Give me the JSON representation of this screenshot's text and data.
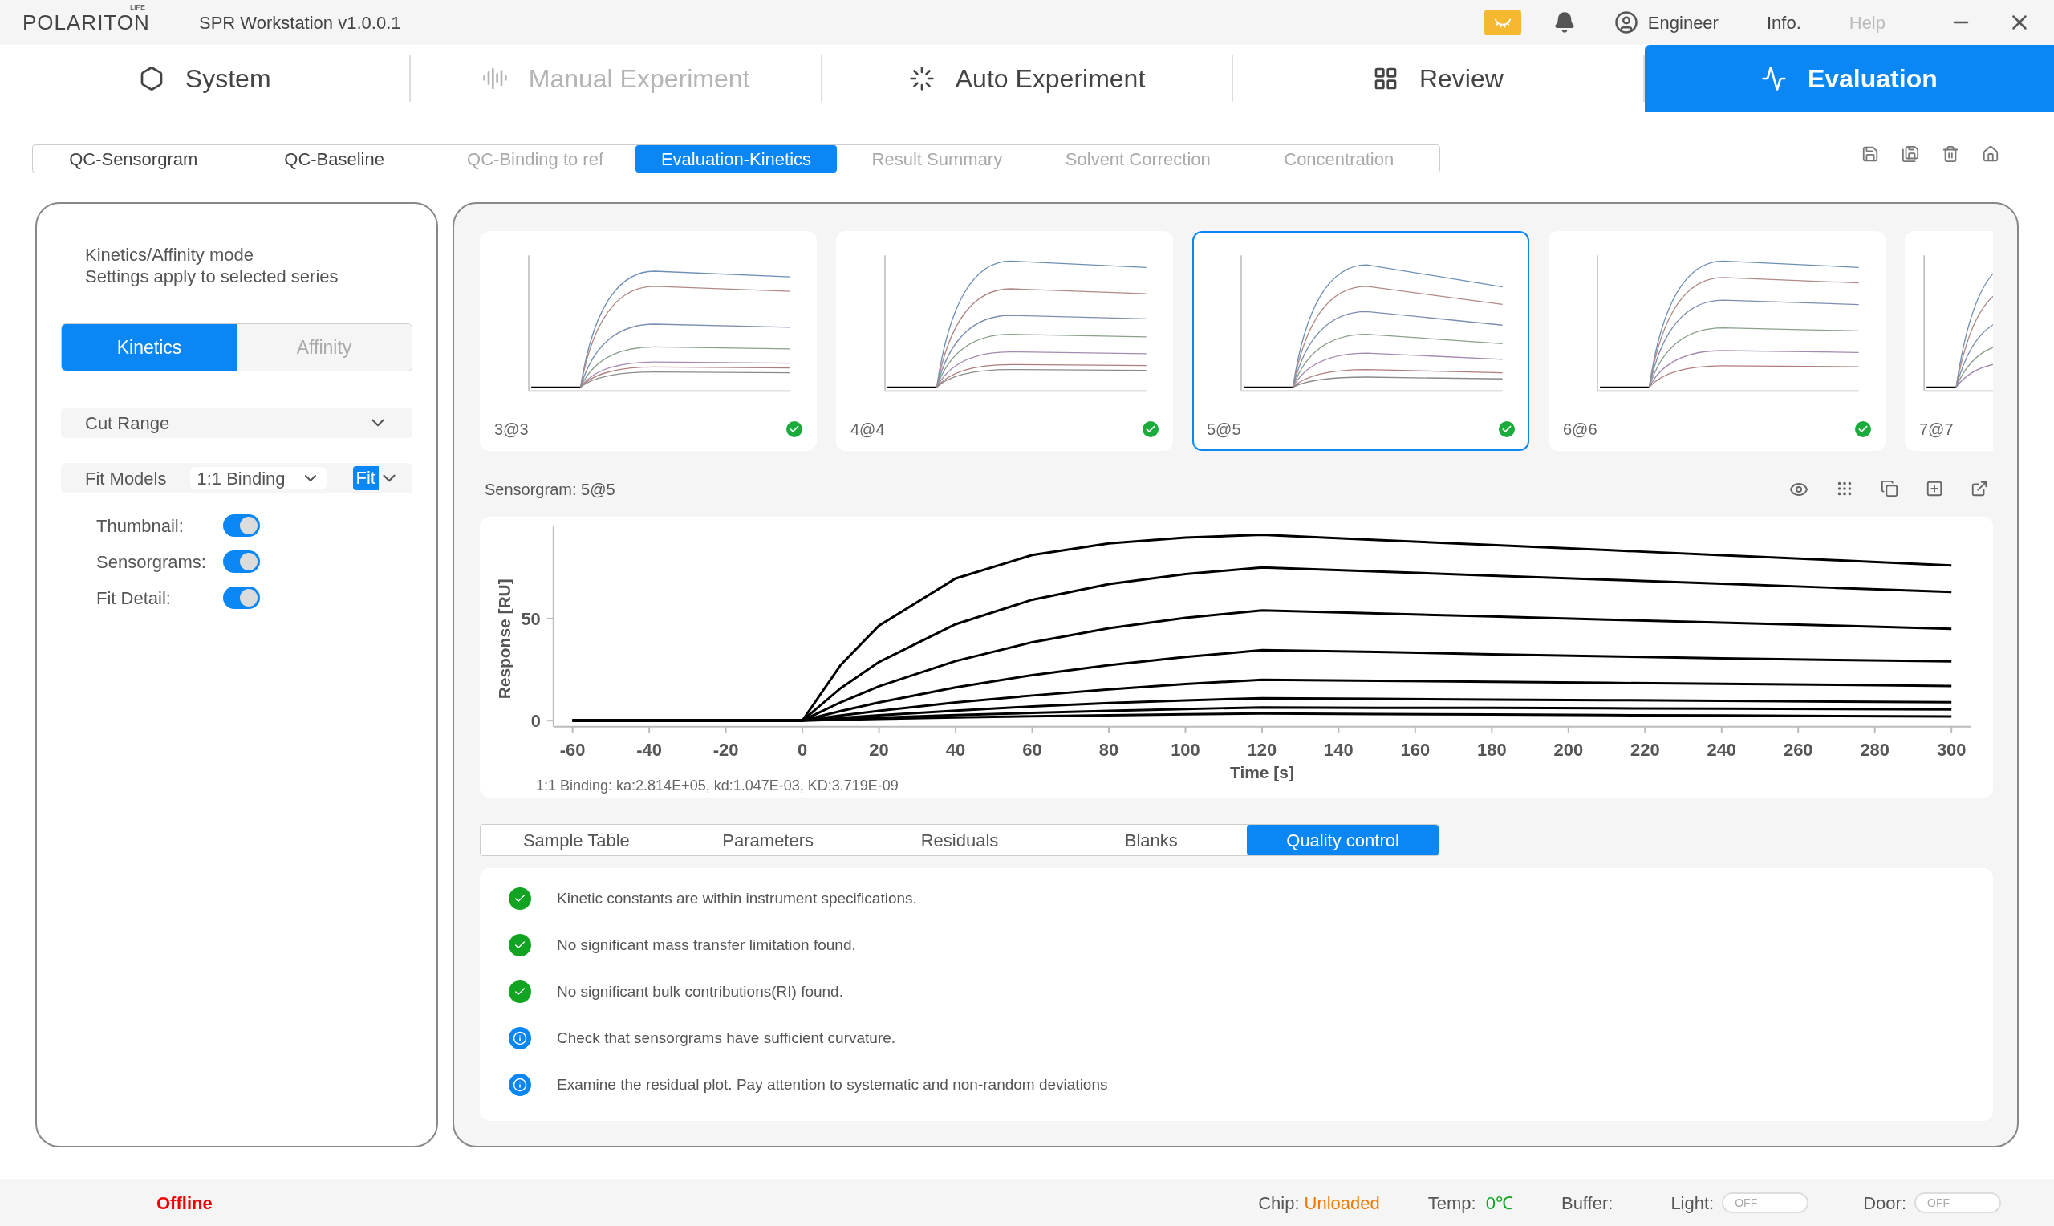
{
  "titlebar": {
    "logo": "POLARITON",
    "logo_super": "LIFE",
    "title": "SPR Workstation v1.0.0.1",
    "user": "Engineer",
    "links": [
      {
        "label": "Info.",
        "disabled": false
      },
      {
        "label": "Help",
        "disabled": true
      }
    ]
  },
  "nav_tabs": [
    {
      "label": "System",
      "kind": "system",
      "selected": false,
      "disabled": false
    },
    {
      "label": "Manual Experiment",
      "kind": "manual",
      "selected": false,
      "disabled": true
    },
    {
      "label": "Auto Experiment",
      "kind": "auto",
      "selected": false,
      "disabled": false
    },
    {
      "label": "Review",
      "kind": "review",
      "selected": false,
      "disabled": false
    },
    {
      "label": "Evaluation",
      "kind": "evaluation",
      "selected": true,
      "disabled": false
    }
  ],
  "sub_tabs": [
    {
      "label": "QC-Sensorgram",
      "selected": false,
      "disabled": false
    },
    {
      "label": "QC-Baseline",
      "selected": false,
      "disabled": false
    },
    {
      "label": "QC-Binding to ref",
      "selected": false,
      "disabled": true
    },
    {
      "label": "Evaluation-Kinetics",
      "selected": true,
      "disabled": false
    },
    {
      "label": "Result Summary",
      "selected": false,
      "disabled": true
    },
    {
      "label": "Solvent Correction",
      "selected": false,
      "disabled": true
    },
    {
      "label": "Concentration",
      "selected": false,
      "disabled": true
    }
  ],
  "settings": {
    "heading": [
      "Kinetics/Affinity mode",
      "Settings apply to selected series"
    ],
    "modes": [
      {
        "label": "Kinetics",
        "selected": true
      },
      {
        "label": "Affinity",
        "selected": false
      }
    ],
    "cut_range": "Cut Range",
    "fit_models_label": "Fit Models",
    "fit_model": "1:1 Binding",
    "fit_button": "Fit",
    "toggles": [
      {
        "label": "Thumbnail:",
        "on": true
      },
      {
        "label": "Sensorgrams:",
        "on": true
      },
      {
        "label": "Fit Detail:",
        "on": true
      }
    ]
  },
  "thumbnails": [
    {
      "label": "3@3",
      "selected": false,
      "passed": true
    },
    {
      "label": "4@4",
      "selected": false,
      "passed": true
    },
    {
      "label": "5@5",
      "selected": true,
      "passed": true
    },
    {
      "label": "6@6",
      "selected": false,
      "passed": true
    },
    {
      "label": "7@7",
      "selected": false
    }
  ],
  "sensorgram": {
    "title": "Sensorgram: 5@5",
    "fit_summary": "1:1 Binding: ka:2.814E+05, kd:1.047E-03, KD:3.719E-09",
    "chart_data": {
      "type": "line",
      "xlabel": "Time [s]",
      "ylabel": "Response [RU]",
      "xlim": [
        -65,
        305
      ],
      "ylim": [
        -3,
        95
      ],
      "xticks": [
        -60,
        -40,
        -20,
        0,
        20,
        40,
        60,
        80,
        100,
        120,
        140,
        160,
        180,
        200,
        220,
        240,
        260,
        280,
        300
      ],
      "yticks": [
        0,
        50
      ],
      "x": [
        -60,
        -30,
        0,
        10,
        20,
        40,
        60,
        80,
        100,
        120,
        150,
        180,
        210,
        240,
        270,
        300
      ],
      "series": [
        {
          "color": "#000000",
          "values": [
            0,
            0,
            0,
            27.3,
            46.5,
            69.6,
            81.1,
            86.8,
            89.6,
            91,
            88.5,
            86,
            83.5,
            81,
            78.5,
            76
          ]
        },
        {
          "color": "#000000",
          "values": [
            0,
            0,
            0,
            15.9,
            28.7,
            47.2,
            59.2,
            66.8,
            71.8,
            75,
            73,
            71,
            69,
            67,
            65,
            63
          ]
        },
        {
          "color": "#000000",
          "values": [
            0,
            0,
            0,
            9,
            16.8,
            29.2,
            38.4,
            45.2,
            50.3,
            54,
            52.5,
            51,
            49.5,
            48,
            46.5,
            45
          ]
        },
        {
          "color": "#000000",
          "values": [
            0,
            0,
            0,
            4.7,
            8.9,
            16.3,
            22.3,
            27.2,
            31.2,
            34.5,
            33.6,
            32.5,
            31.5,
            30.5,
            29.7,
            29
          ]
        },
        {
          "color": "#000000",
          "values": [
            0,
            0,
            0,
            2.5,
            4.8,
            8.9,
            12.3,
            15.3,
            17.9,
            20,
            19.5,
            19,
            18.5,
            18,
            17.5,
            17
          ]
        },
        {
          "color": "#000000",
          "values": [
            0,
            0,
            0,
            1.3,
            2.6,
            4.9,
            6.9,
            8.6,
            9.9,
            11,
            10.7,
            10.3,
            10,
            9.7,
            9.3,
            9
          ]
        },
        {
          "color": "#000000",
          "values": [
            0,
            0,
            0,
            0.7,
            1.4,
            2.7,
            3.8,
            4.8,
            5.7,
            6.5,
            6.3,
            6.2,
            6,
            5.9,
            5.7,
            5.5
          ]
        },
        {
          "color": "#000000",
          "values": [
            0,
            0,
            0,
            0.4,
            0.8,
            1.5,
            2.1,
            2.6,
            3.1,
            3.5,
            3.2,
            3,
            2.7,
            2.5,
            2.2,
            2
          ]
        }
      ]
    }
  },
  "result_tabs": [
    {
      "label": "Sample Table",
      "selected": false
    },
    {
      "label": "Parameters",
      "selected": false
    },
    {
      "label": "Residuals",
      "selected": false
    },
    {
      "label": "Blanks",
      "selected": false
    },
    {
      "label": "Quality control",
      "selected": true
    }
  ],
  "quality_checks": [
    {
      "kind": "pass",
      "text": "Kinetic constants are within instrument specifications."
    },
    {
      "kind": "pass",
      "text": "No significant mass transfer limitation found."
    },
    {
      "kind": "pass",
      "text": "No significant bulk contributions(RI) found."
    },
    {
      "kind": "info",
      "text": "Check that sensorgrams have sufficient curvature."
    },
    {
      "kind": "info",
      "text": "Examine the residual plot. Pay attention to systematic and non-random deviations"
    }
  ],
  "status_bar": {
    "connection": "Offline",
    "chip_label": "Chip:",
    "chip": "Unloaded",
    "temp_label": "Temp:",
    "temp": "0℃",
    "buffer_label": "Buffer:",
    "switches": [
      {
        "label": "Light:",
        "state": "OFF",
        "on": false
      },
      {
        "label": "Door:",
        "state": "OFF",
        "on": false
      }
    ]
  }
}
